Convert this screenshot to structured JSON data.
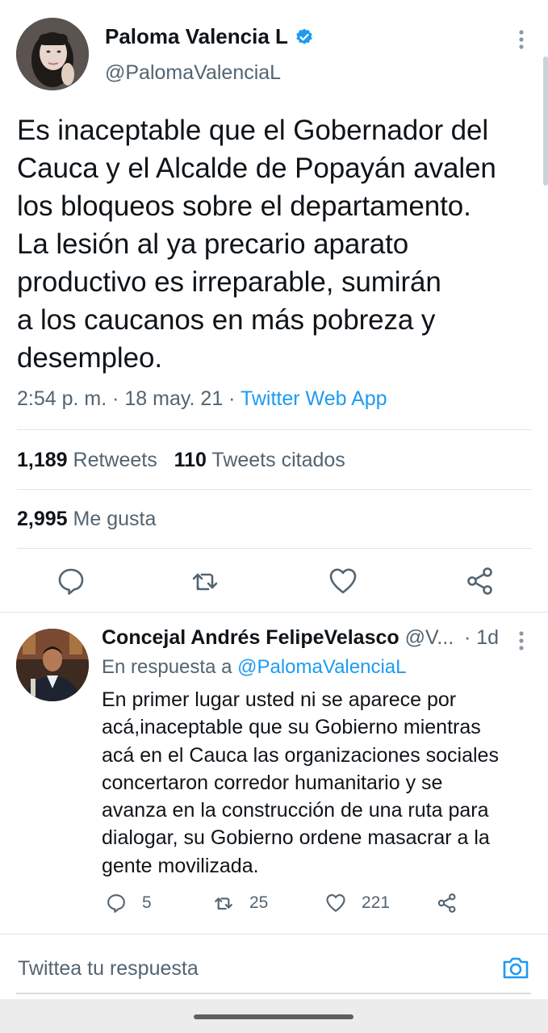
{
  "tweet": {
    "author_name": "Paloma Valencia L",
    "author_handle": "@PalomaValenciaL",
    "verified": true,
    "text": "Es inaceptable que el Gobernador del\nCauca y el Alcalde de Popayán avalen\nlos bloqueos sobre el departamento.\nLa lesión al ya precario aparato\nproductivo es irreparable, sumirán\na los caucanos en más pobreza y\ndesempleo.",
    "time": "2:54 p. m.",
    "date": "18 may. 21",
    "separator": " · ",
    "source_app": "Twitter Web App",
    "retweets_count": "1,189",
    "retweets_label": "Retweets",
    "quotes_count": "110",
    "quotes_label": "Tweets citados",
    "likes_count": "2,995",
    "likes_label": "Me gusta"
  },
  "reply": {
    "author_name": "Concejal Andrés FelipeVelasco",
    "author_handle": "@V...",
    "time": "· 1d",
    "replying_to_label": "En respuesta a",
    "replying_to_handle": "@PalomaValenciaL",
    "text": "En primer lugar usted ni se aparece por\nacá,inaceptable que su Gobierno mientras\nacá en el Cauca las organizaciones sociales\nconcertaron corredor humanitario y se\navanza en la construcción de una ruta para\ndialogar, su Gobierno ordene masacrar a la\ngente movilizada.",
    "reply_count": "5",
    "retweet_count": "25",
    "like_count": "221"
  },
  "compose": {
    "placeholder": "Twittea tu respuesta"
  },
  "icons": {
    "verified": "verified-badge-icon",
    "more": "more-vertical-icon",
    "reply": "reply-icon",
    "retweet": "retweet-icon",
    "like": "heart-icon",
    "share": "share-icon",
    "camera": "camera-icon"
  },
  "colors": {
    "accent": "#1d9bf0",
    "text_primary": "#0f1419",
    "text_secondary": "#536471",
    "divider": "#e1e6ea"
  }
}
